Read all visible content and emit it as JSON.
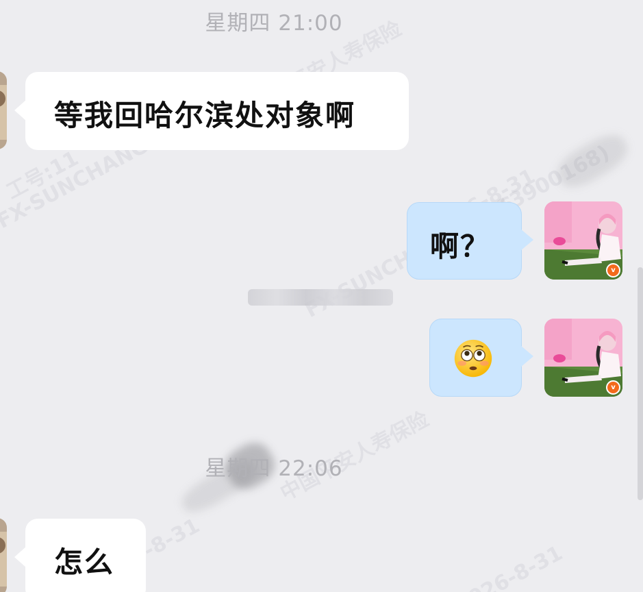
{
  "time_separators": [
    {
      "label": "星期四  21:00"
    },
    {
      "label": "星期四  22:06"
    }
  ],
  "messages": [
    {
      "direction": "incoming",
      "text": "等我回哈尔滨处对象啊"
    },
    {
      "direction": "outgoing",
      "text": "啊？"
    },
    {
      "direction": "outgoing",
      "emoji": "flushed-face"
    },
    {
      "direction": "incoming",
      "text": "怎么"
    }
  ],
  "watermark": {
    "company": "中国平安人寿保险",
    "staff_id": "工号:11",
    "account": "FX-SUNCHANGBI396",
    "phone": "13900168)",
    "date": "2026-8-31"
  },
  "colors": {
    "background": "#ededf0",
    "incoming_bubble": "#ffffff",
    "outgoing_bubble": "#cce6fe",
    "timestamp_text": "#b1b1b6",
    "vip_badge": "#f46a1c"
  },
  "icons": {
    "vip_badge": "vip-badge-icon",
    "emoji": "flushed-face-emoji"
  }
}
